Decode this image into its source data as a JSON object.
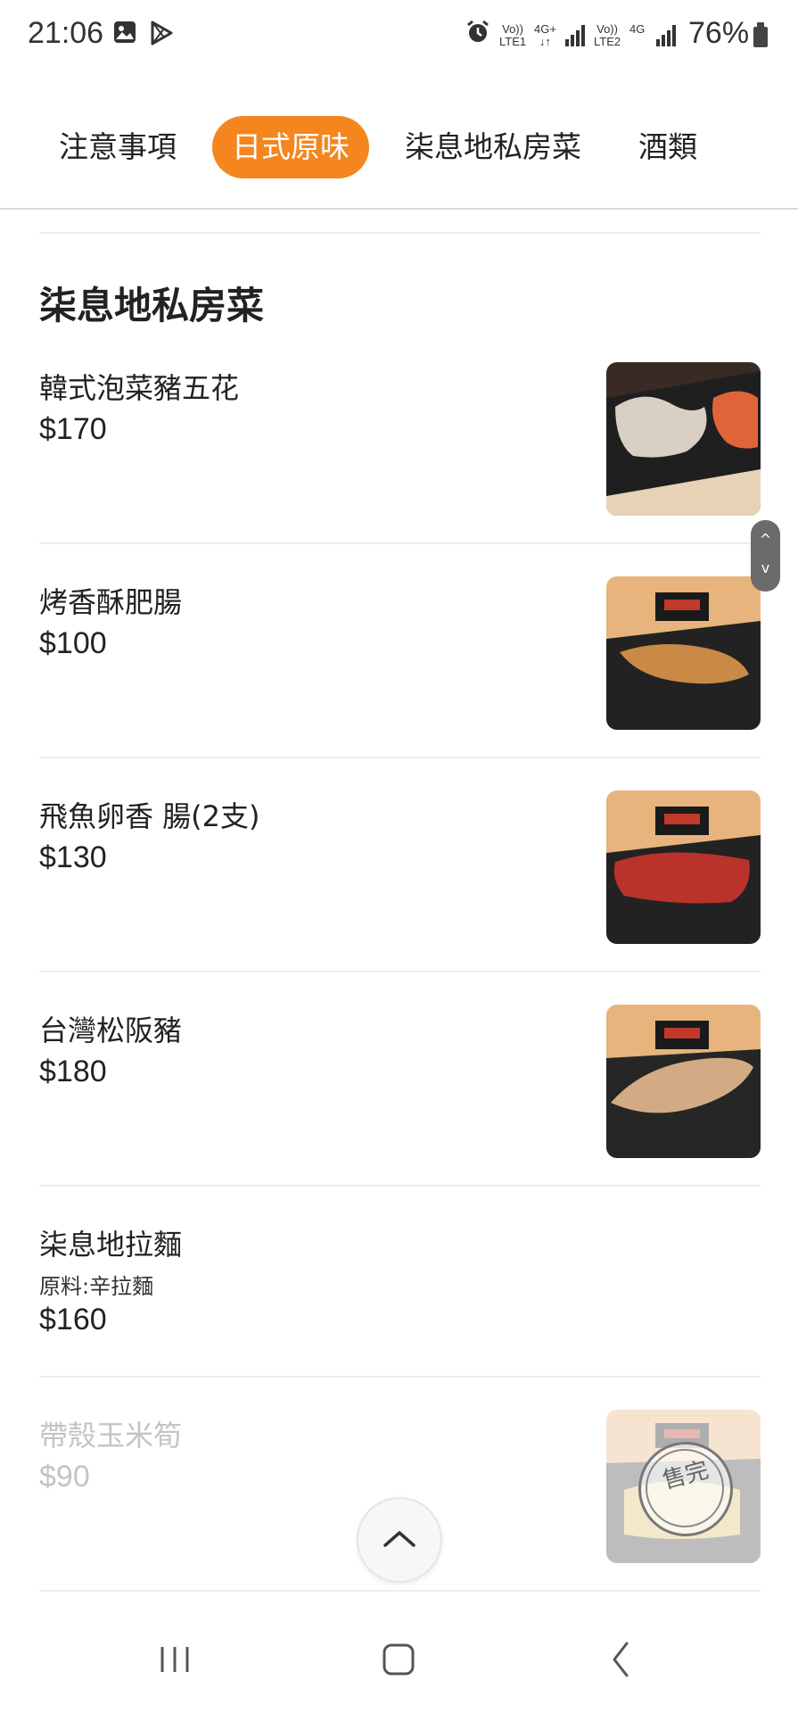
{
  "status_bar": {
    "time": "21:06",
    "icons": [
      "gallery-icon",
      "play-store-icon",
      "alarm-icon",
      "signal-icon",
      "signal-icon"
    ],
    "sim1_top": "Vo))",
    "sim1_bottom": "LTE1",
    "net1_top": "4G+",
    "net1_bottom": "↓↑",
    "sim2_top": "Vo))",
    "sim2_bottom": "LTE2",
    "net2_top": "4G",
    "battery": "76%"
  },
  "tabs": [
    {
      "label": "注意事項",
      "active": false
    },
    {
      "label": "日式原味",
      "active": true
    },
    {
      "label": "柒息地私房菜",
      "active": false
    },
    {
      "label": "酒類",
      "active": false
    }
  ],
  "section": {
    "title": "柒息地私房菜"
  },
  "items": [
    {
      "name": "韓式泡菜豬五花",
      "price": "$170",
      "has_image": true
    },
    {
      "name": "烤香酥肥腸",
      "price": "$100",
      "has_image": true
    },
    {
      "name": "飛魚卵香 腸(2支)",
      "price": "$130",
      "has_image": true
    },
    {
      "name": "台灣松阪豬",
      "price": "$180",
      "has_image": true
    },
    {
      "name": "柒息地拉麵",
      "description": "原料:辛拉麵",
      "price": "$160",
      "has_image": false
    },
    {
      "name": "帶殼玉米筍",
      "price": "$90",
      "has_image": true,
      "sold_out": true,
      "sold_out_label": "售完"
    }
  ],
  "colors": {
    "accent": "#f5851f",
    "text": "#222222",
    "muted": "#c4c4c4",
    "divider": "#ececec"
  },
  "controls": {
    "back_to_top": "chevron-up-icon",
    "scroll_handle": "scroll-handle"
  },
  "nav_bar": {
    "buttons": [
      "recent-apps-icon",
      "home-icon",
      "back-icon"
    ]
  }
}
